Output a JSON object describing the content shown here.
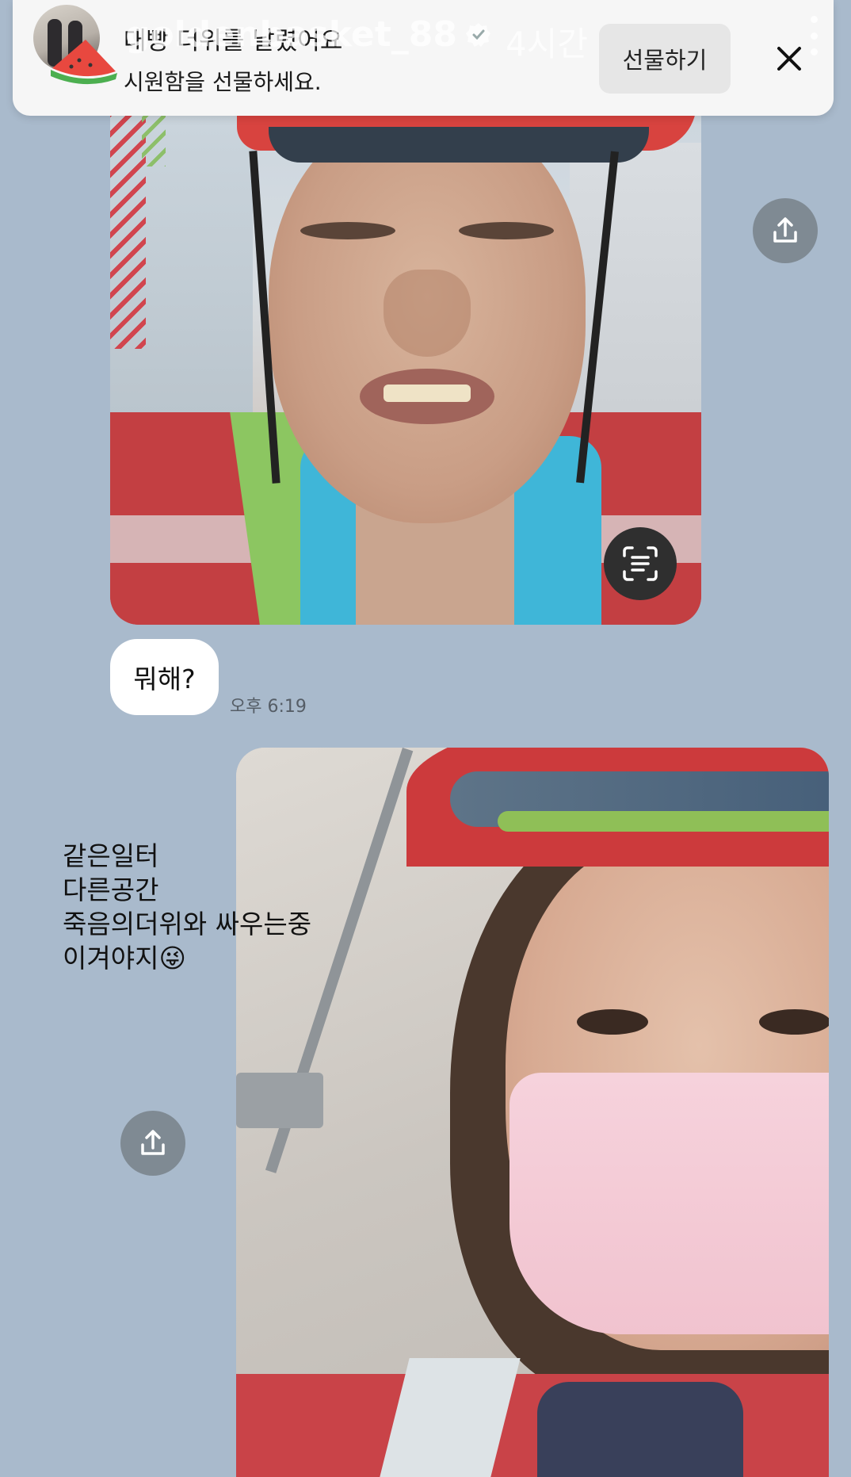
{
  "notification": {
    "title": "대빵 더위를 날렸어요",
    "subtitle": "시원함을 선물하세요.",
    "gift_button": "선물하기",
    "close_icon": "close-icon"
  },
  "story": {
    "username": "goldenbasket_88",
    "verified_icon": "verified-badge-icon",
    "time_ago": "4시간",
    "more_icon": "more-vertical-icon"
  },
  "chat": {
    "message": "뭐해?",
    "time": "오후 6:19"
  },
  "overlay_text": "같은일터\n다른공간\n죽음의더위와 싸우는중\n이겨야지😜",
  "icons": {
    "share": "share-upload-icon",
    "scan": "text-scan-icon"
  },
  "colors": {
    "background": "#a9bacc",
    "bubble": "#ffffff",
    "button_gray": "#7f8a93"
  }
}
